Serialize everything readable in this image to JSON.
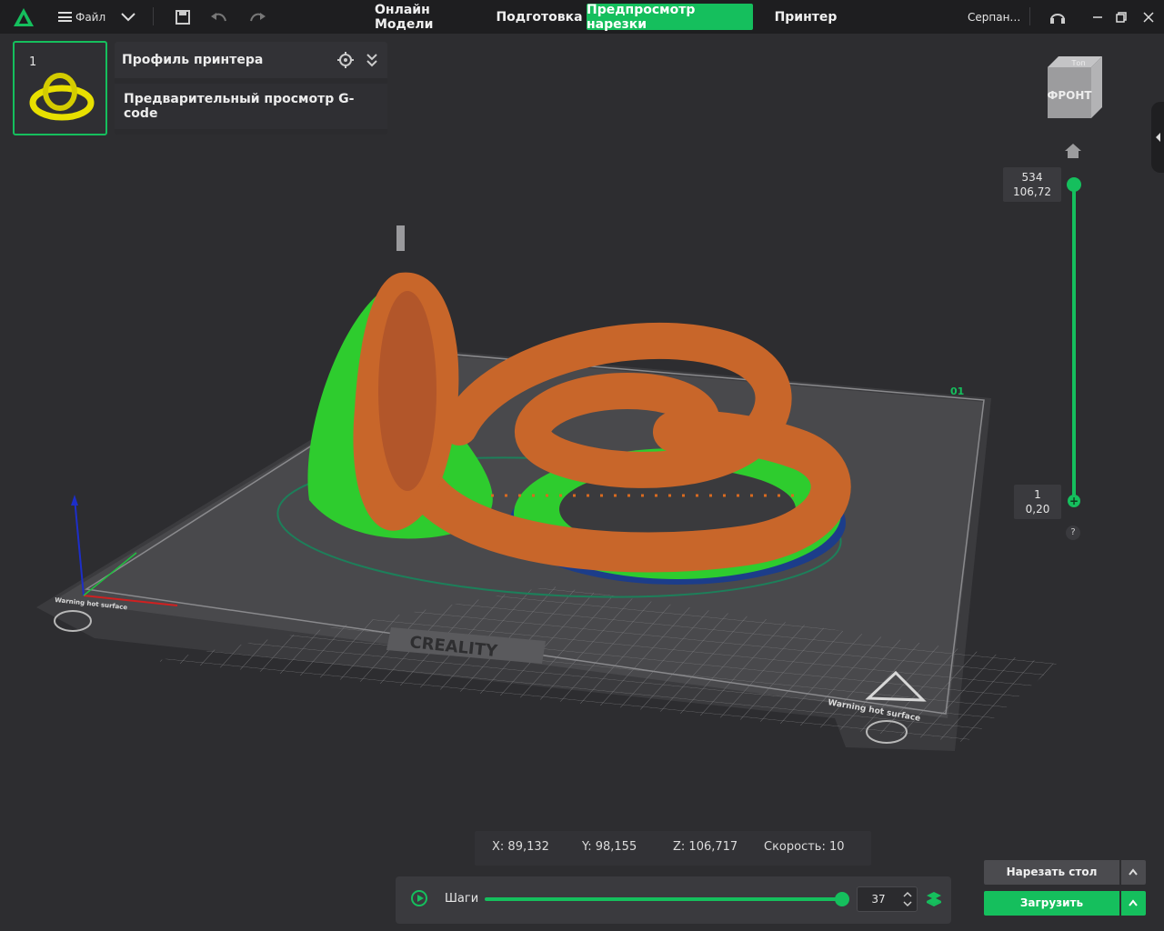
{
  "topbar": {
    "file_label": "Файл",
    "tabs": [
      {
        "label": "Онлайн Модели",
        "active": false
      },
      {
        "label": "Подготовка",
        "active": false
      },
      {
        "label": "Предпросмотр нарезки",
        "active": true
      },
      {
        "label": "Принтер",
        "active": false
      }
    ],
    "user_label": "Серпан…"
  },
  "plate_panel": {
    "plate_number": "1",
    "profile_title": "Профиль принтера",
    "gcode_label": "Предварительный просмотр G-code"
  },
  "viewcube": {
    "front_label": "ФРОНТ",
    "top_label": "Топ"
  },
  "bed": {
    "brand_label": "CREALITY",
    "warning_label": "Warning hot surface",
    "plate_tag": "01"
  },
  "layer_slider": {
    "top_layer": "534",
    "top_height": "106,72",
    "bottom_layer": "1",
    "bottom_height": "0,20",
    "help": "?"
  },
  "coords": {
    "x": "X: 89,132",
    "y": "Y: 98,155",
    "z": "Z: 106,717",
    "speed": "Скорость: 10"
  },
  "steps": {
    "label": "Шаги",
    "value": "37",
    "progress": 1.0
  },
  "actions": {
    "slice_label": "Нарезать стол",
    "upload_label": "Загрузить"
  },
  "colors": {
    "accent": "#15bf5d",
    "background": "#2d2d30",
    "topbar": "#1e1e20",
    "model_wall": "#c8662a",
    "model_support": "#2ecc2e",
    "model_bottom": "#1c3d8a"
  }
}
